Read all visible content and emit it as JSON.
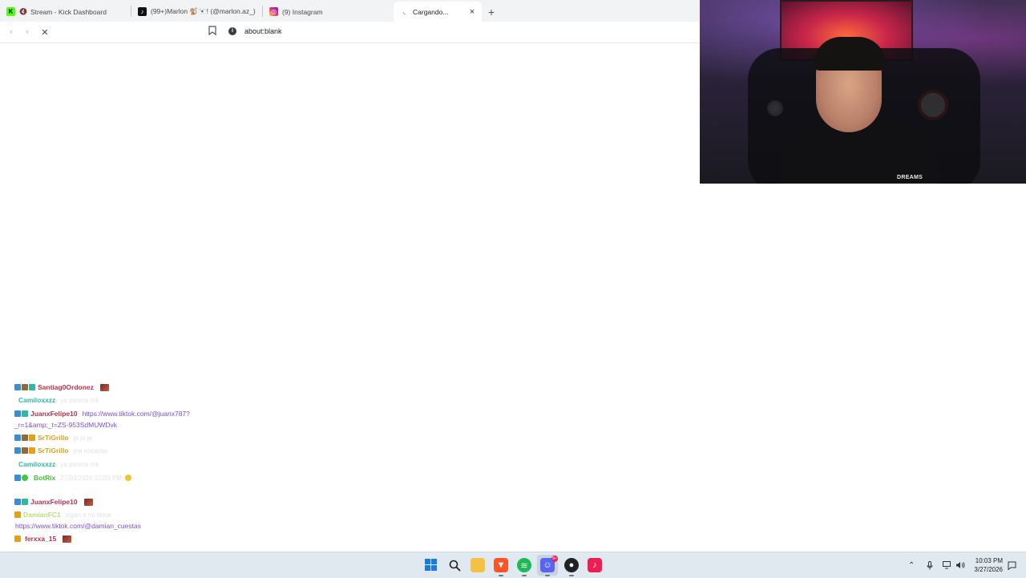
{
  "browser": {
    "tabs": [
      {
        "title": "Stream - Kick Dashboard",
        "favicon": "kick-icon",
        "muted": true
      },
      {
        "title": "(99+)Marlon 🐒🐻‍❄️! (@marlon.az_) |",
        "favicon": "tiktok-icon"
      },
      {
        "title": "(9) Instagram",
        "favicon": "instagram-icon"
      },
      {
        "title": "Cargando...",
        "favicon": "loading-icon",
        "active": true
      }
    ],
    "new_tab_label": "+",
    "close_label": "×",
    "url": "about:blank"
  },
  "webcam": {
    "shirt_text": "DREAMS"
  },
  "chat": [
    {
      "user": "Santiag0Ordonez",
      "color": "#c0304a",
      "badges": [
        "blue",
        "brown",
        "teal"
      ],
      "emote": true
    },
    {
      "user": "Camiloxxzz",
      "color": "#2fb8a0",
      "badges": [],
      "text": "ya parece mk"
    },
    {
      "user": "JuanxFelipe10",
      "color": "#c0304a",
      "badges": [
        "blue",
        "teal"
      ],
      "link": "https://www.tiktok.com/@juanx787?",
      "cont": "_r=1&amp;_t=ZS-953SdMUWDvk"
    },
    {
      "user": "SrTiGrillo",
      "color": "#d9a21a",
      "badges": [
        "blue",
        "brown",
        "orange"
      ],
      "text": "ja ja ja"
    },
    {
      "user": "SrTiGrillo",
      "color": "#d9a21a",
      "badges": [
        "blue",
        "brown",
        "orange"
      ],
      "text": "me encanta"
    },
    {
      "user": "Camiloxxzz",
      "color": "#2fb8a0",
      "badges": [],
      "text": "ya parece mk"
    },
    {
      "user": "BotRix",
      "color": "#46c23a",
      "badges": [
        "blue",
        "green"
      ],
      "text": "27/03/2026 10:03 PM"
    },
    {
      "user": "JuanxFelipe10",
      "color": "#c0304a",
      "badges": [
        "blue",
        "teal"
      ],
      "emote": true
    },
    {
      "user": "DamianFC1",
      "color": "#b9e07a",
      "badges": [
        "orange"
      ],
      "text": "sigan a mi tiktok",
      "cont": "https://www.tiktok.com/@damian_cuestas"
    },
    {
      "user": "ferxxa_15",
      "color": "#c0304a",
      "badges": [
        "orange"
      ],
      "emote": true
    }
  ],
  "taskbar": {
    "discord_badge": "9+",
    "time": "10:03 PM",
    "date": "3/27/2026"
  },
  "colors": {
    "tabstrip_bg": "#f2f3f5",
    "taskbar_bg": "#dfe9ef",
    "link_purple": "#7e4fd6"
  }
}
